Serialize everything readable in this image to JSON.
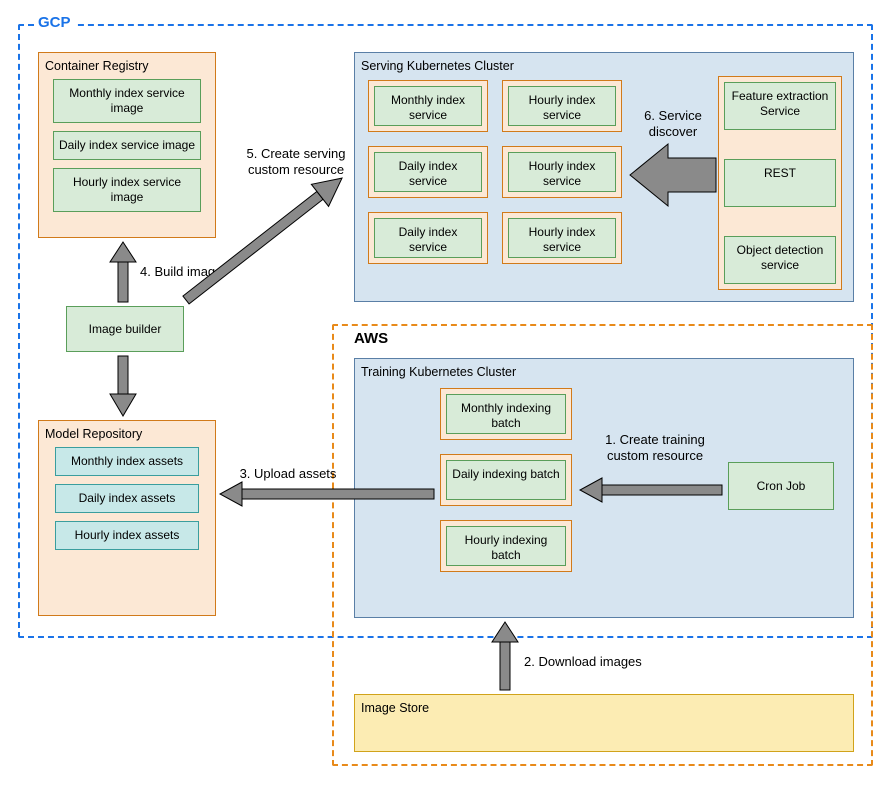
{
  "regions": {
    "gcp": "GCP",
    "aws": "AWS"
  },
  "containerRegistry": {
    "title": "Container Registry",
    "items": [
      "Monthly index service image",
      "Daily index service image",
      "Hourly index service image"
    ]
  },
  "modelRepository": {
    "title": "Model Repository",
    "items": [
      "Monthly index assets",
      "Daily index assets",
      "Hourly index assets"
    ]
  },
  "imageBuilder": "Image builder",
  "servingCluster": {
    "title": "Serving Kubernetes Cluster",
    "col1": [
      "Monthly index service",
      "Daily index service",
      "Daily index service"
    ],
    "col2": [
      "Hourly index service",
      "Hourly index service",
      "Hourly index service"
    ],
    "col3": [
      "Feature extraction Service",
      "REST",
      "Object detection service"
    ]
  },
  "trainingCluster": {
    "title": "Training Kubernetes Cluster",
    "items": [
      "Monthly indexing batch",
      "Daily indexing batch",
      "Hourly indexing batch"
    ],
    "cronJob": "Cron Job"
  },
  "imageStore": {
    "title": "Image Store"
  },
  "captions": {
    "step1": "1. Create training custom resource",
    "step2": "2. Download images",
    "step3": "3. Upload assets",
    "step4": "4. Build image",
    "step5": "5. Create serving custom resource",
    "step6": "6. Service discover"
  }
}
